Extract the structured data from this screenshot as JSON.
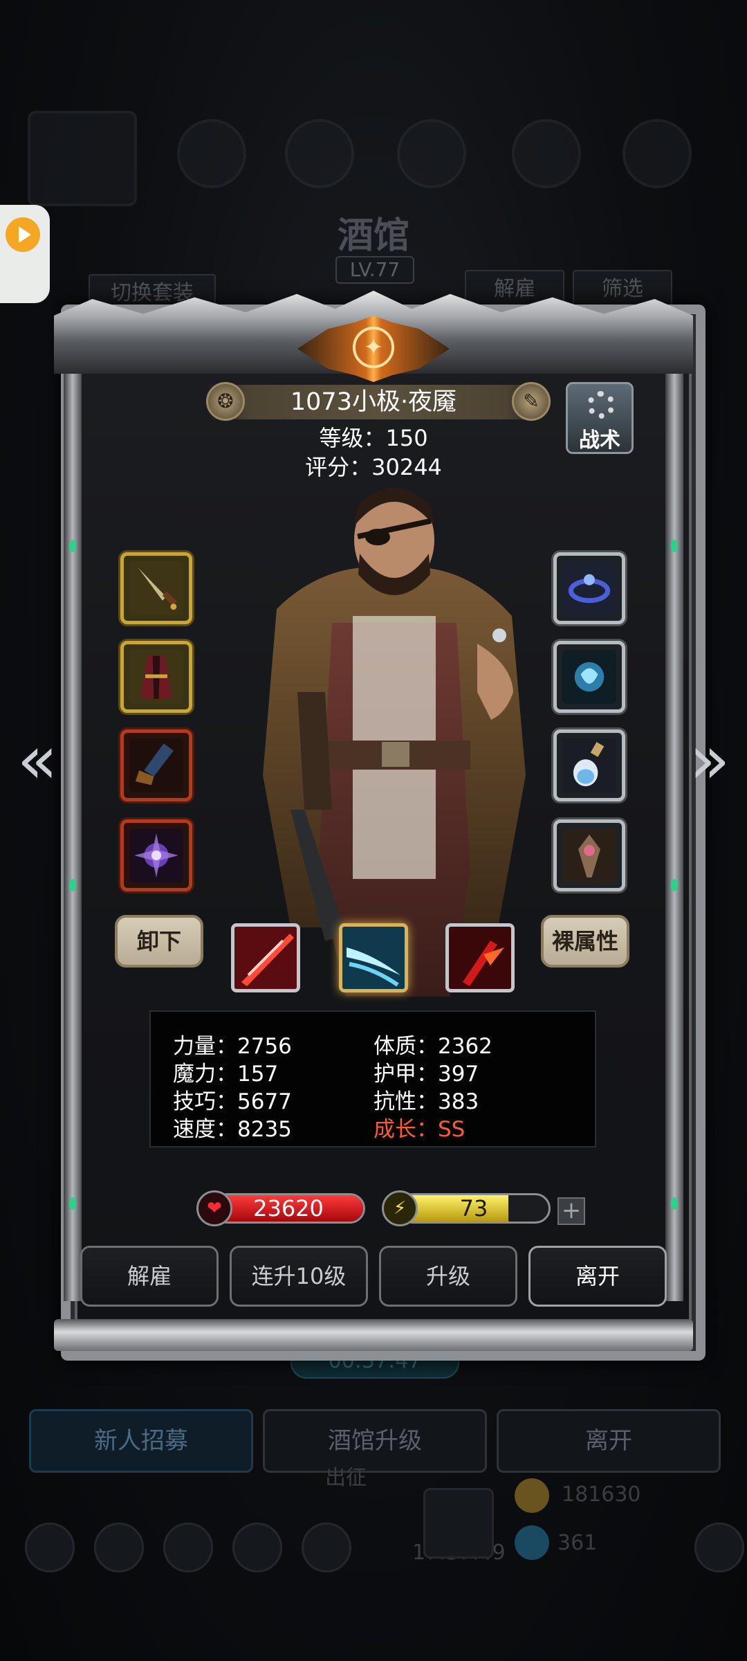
{
  "background": {
    "title": "酒馆",
    "level": "LV.77",
    "tab_switch_outfit": "切换套装",
    "tab_dismiss": "解雇",
    "tab_filter": "筛选",
    "timer": "00:37:47",
    "btn_recruit": "新人招募",
    "btn_upgrade_tavern": "酒馆升级",
    "btn_leave": "离开",
    "bottom_label": "出征",
    "gold": "181630",
    "gems": "361",
    "clock": "17:37:49"
  },
  "hero": {
    "name": "1073小极·夜魇",
    "level_label": "等级：",
    "level_value": "150",
    "score_label": "评分：",
    "score_value": "30244"
  },
  "tactics_label": "战术",
  "left_slots": [
    {
      "icon": "dagger-icon"
    },
    {
      "icon": "robe-icon"
    },
    {
      "icon": "boots-icon"
    },
    {
      "icon": "shadow-orb-icon"
    }
  ],
  "right_slots": [
    {
      "icon": "ring-icon"
    },
    {
      "icon": "amulet-icon"
    },
    {
      "icon": "potion-icon"
    },
    {
      "icon": "charm-icon"
    }
  ],
  "btn_unequip": "卸下",
  "btn_base_attr": "裸属性",
  "skills": [
    {
      "icon": "red-slash-icon"
    },
    {
      "icon": "ice-blade-icon"
    },
    {
      "icon": "fire-strike-icon"
    }
  ],
  "attributes": {
    "strength_label": "力量：",
    "strength": "2756",
    "magic_label": "魔力：",
    "magic": "157",
    "skill_label": "技巧：",
    "skill": "5677",
    "speed_label": "速度：",
    "speed": "8235",
    "constitution_label": "体质：",
    "constitution": "2362",
    "armor_label": "护甲：",
    "armor": "397",
    "resistance_label": "抗性：",
    "resistance": "383",
    "growth_label": "成长：",
    "growth": "SS"
  },
  "hp": {
    "value": "23620",
    "fill_fraction": 1.0
  },
  "energy": {
    "value": "73",
    "fill_fraction": 0.73
  },
  "actions": {
    "dismiss": "解雇",
    "level_up_10": "连升10级",
    "upgrade": "升级",
    "leave": "离开"
  },
  "colors": {
    "growth": "#ff5a2c",
    "hp": "#d4141c",
    "energy": "#e8d21e",
    "slot_gold": "#c9a637",
    "slot_red": "#b33a1f"
  }
}
